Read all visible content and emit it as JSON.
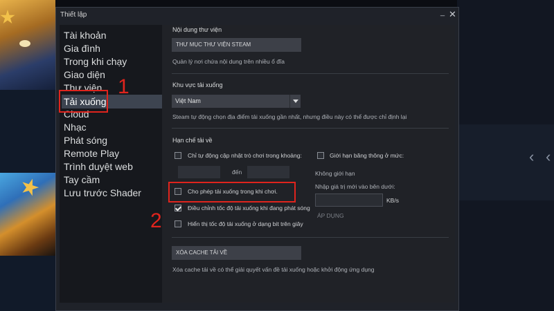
{
  "window": {
    "title": "Thiết lập",
    "minimize_glyph": "_",
    "close_glyph": "✕"
  },
  "sidebar": {
    "items": [
      {
        "label": "Tài khoản"
      },
      {
        "label": "Gia đình"
      },
      {
        "label": "Trong khi chạy"
      },
      {
        "label": "Giao diện"
      },
      {
        "label": "Thư viện"
      },
      {
        "label": "Tải xuống",
        "selected": true
      },
      {
        "label": "Cloud"
      },
      {
        "label": "Nhạc"
      },
      {
        "label": "Phát sóng"
      },
      {
        "label": "Remote Play"
      },
      {
        "label": "Trình duyệt web"
      },
      {
        "label": "Tay cầm"
      },
      {
        "label": "Lưu trước Shader"
      }
    ]
  },
  "library": {
    "heading": "Nội dung thư viện",
    "button": "THƯ MỤC THƯ VIỆN STEAM",
    "desc": "Quản lý nơi chứa nội dung trên nhiều ổ đĩa"
  },
  "region": {
    "heading": "Khu vực tải xuống",
    "selected": "Việt Nam",
    "desc": "Steam tự động chọn địa điểm tải xuống gần nhất, nhưng điều này có thể được chỉ định lại"
  },
  "limits": {
    "heading": "Hạn chế tải về",
    "auto_update_only": {
      "label": "Chỉ tự động cập nhật trò chơi trong khoảng:",
      "checked": false
    },
    "time_between": "đến",
    "allow_while_playing": {
      "label": "Cho phép tải xuống trong khi chơi.",
      "checked": false
    },
    "throttle_broadcast": {
      "label": "Điều chỉnh tốc độ tải xuống khi đang phát sóng",
      "checked": true
    },
    "show_bits": {
      "label": "Hiển thị tốc độ tải xuống ở dạng bit trên giây",
      "checked": false
    },
    "bandwidth": {
      "label": "Giới hạn băng thông ở mức:",
      "checked": false
    },
    "no_limit": "Không giới hạn",
    "enter_value": "Nhập giá trị mới vào bên dưới:",
    "unit": "KB/s",
    "apply": "ÁP DỤNG"
  },
  "cache": {
    "button": "XÓA CACHE TẢI VỀ",
    "desc": "Xóa cache tải về có thể giải quyết vấn đề tải xuống hoặc khởi động ứng dụng"
  },
  "annotations": {
    "step1": "1",
    "step2": "2",
    "color": "#e0241d"
  },
  "background": {
    "prev_glyph": "‹",
    "next_glyph": "‹"
  }
}
